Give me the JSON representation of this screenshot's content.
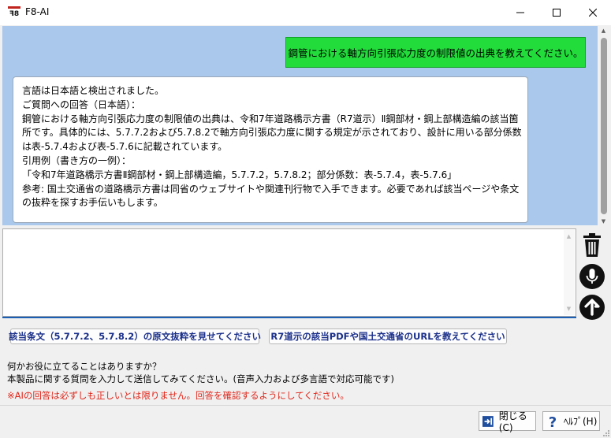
{
  "window": {
    "title": "F8-AI",
    "app_icon": "f8-logo-icon",
    "minimize_icon": "minimize-icon",
    "maximize_icon": "maximize-icon",
    "close_icon": "close-icon"
  },
  "chat": {
    "user_message": "鋼管における軸方向引張応力度の制限値の出典を教えてください。",
    "user_bubble_color": "#22dc3b",
    "background_color": "#a9c8ec",
    "ai_response_lines": [
      "言語は日本語と検出されました。",
      "ご質問への回答（日本語）：",
      "鋼管における軸方向引張応力度の制限値の出典は、令和7年道路橋示方書（R7道示）Ⅱ鋼部材・鋼上部構造編の該当箇",
      "所です。具体的には、5.7.7.2および5.7.8.2で軸方向引張応力度に関する規定が示されており、設計に用いる部分係数",
      "は表-5.7.4および表-5.7.6に記載されています。",
      "引用例（書き方の一例）：",
      "「令和7年道路橋示方書Ⅱ鋼部材・鋼上部構造編，5.7.7.2，5.7.8.2；部分係数：表-5.7.4，表-5.7.6」",
      "参考: 国土交通省の道路橋示方書は同省のウェブサイトや関連刊行物で入手できます。必要であれば該当ページや条文",
      "の抜粋を探すお手伝いもします。"
    ]
  },
  "input": {
    "value": "",
    "placeholder": ""
  },
  "side_buttons": {
    "delete_icon": "trash-icon",
    "voice_icon": "microphone-icon",
    "send_icon": "send-arrow-up-icon"
  },
  "suggestions": [
    "該当条文（5.7.7.2、5.7.8.2）の原文抜粋を見せてください",
    "R7道示の該当PDFや国土交通省のURLを教えてください"
  ],
  "info": {
    "line1": "何かお役に立てることはありますか？",
    "line2": "本製品に関する質問を入力して送信してみてください。(音声入力および多言語で対応可能です)",
    "warning": "※AIの回答は必ずしも正しいとは限りません。回答を確認するようにしてください。",
    "warning_color": "#e0261a"
  },
  "footer": {
    "close_label": "閉じる(C)",
    "help_label": "ﾍﾙﾌﾟ(H)",
    "close_icon": "exit-door-icon",
    "help_icon": "help-question-icon"
  }
}
